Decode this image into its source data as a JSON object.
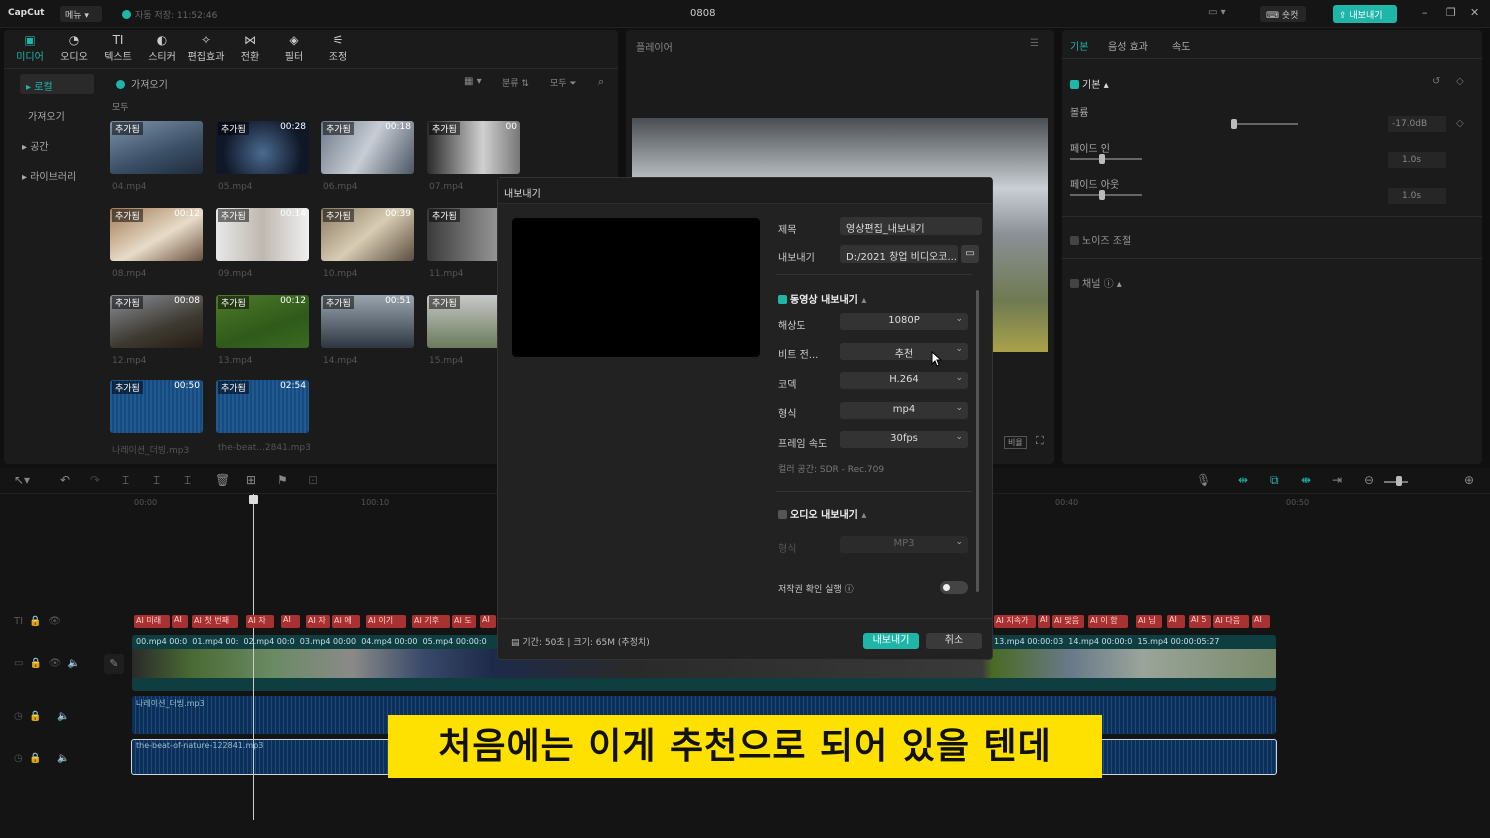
{
  "topbar": {
    "logo": "CapCut",
    "menu": "메뉴",
    "autosave": "자동 저장: 11:52:46",
    "project_name": "0808",
    "shortcut": "숏컷",
    "export": "내보내기"
  },
  "media_tabs": [
    "미디어",
    "오디오",
    "텍스트",
    "스티커",
    "편집효과",
    "전환",
    "필터",
    "조정"
  ],
  "sidebar": [
    "로컬",
    "가져오기",
    "공간",
    "라이브러리"
  ],
  "media_header": {
    "import": "가져오기",
    "sort": "분류",
    "all_filter": "모두",
    "section": "모두"
  },
  "media_items": [
    {
      "tag": "추가됨",
      "dur": "",
      "name": "04.mp4"
    },
    {
      "tag": "추가됨",
      "dur": "00:28",
      "name": "05.mp4"
    },
    {
      "tag": "추가됨",
      "dur": "00:18",
      "name": "06.mp4"
    },
    {
      "tag": "추가됨",
      "dur": "00",
      "name": "07.mp4"
    },
    {
      "tag": "추가됨",
      "dur": "00:12",
      "name": "08.mp4"
    },
    {
      "tag": "추가됨",
      "dur": "00:14",
      "name": "09.mp4"
    },
    {
      "tag": "추가됨",
      "dur": "00:39",
      "name": "10.mp4"
    },
    {
      "tag": "추가됨",
      "dur": "",
      "name": "11.mp4"
    },
    {
      "tag": "추가됨",
      "dur": "00:08",
      "name": "12.mp4"
    },
    {
      "tag": "추가됨",
      "dur": "00:12",
      "name": "13.mp4"
    },
    {
      "tag": "추가됨",
      "dur": "00:51",
      "name": "14.mp4"
    },
    {
      "tag": "추가됨",
      "dur": "",
      "name": "15.mp4"
    },
    {
      "tag": "추가됨",
      "dur": "00:50",
      "name": "나레이션_더빙.mp3"
    },
    {
      "tag": "추가됨",
      "dur": "02:54",
      "name": "the-beat...2841.mp3"
    }
  ],
  "player": {
    "title": "플레이어",
    "ratio": "비율"
  },
  "right_panel": {
    "tabs": [
      "기본",
      "음성 효과",
      "속도"
    ],
    "basic": "기본",
    "volume_label": "볼륨",
    "volume_value": "-17.0dB",
    "fade_in_label": "페이드 인",
    "fade_in_value": "1.0s",
    "fade_out_label": "페이드 아웃",
    "fade_out_value": "1.0s",
    "noise": "노이즈 조절",
    "channel": "채널"
  },
  "timeline": {
    "ticks": [
      "00:00",
      "100:10",
      "00:40",
      "00:50"
    ],
    "audio1": "나레이션_더빙.mp3",
    "audio2": "the-beat-of-nature-122841.mp3",
    "video_clips": [
      "00.mp4",
      "00:0",
      "01.mp4",
      "00:",
      "02.mp4",
      "00:0",
      "03.mp4",
      "00:00",
      "04.mp4",
      "00:00",
      "05.mp4",
      "00:00:0",
      "13.mp4",
      "00:00:03",
      "14.mp4",
      "00:00:0",
      "15.mp4",
      "00:00:05:27"
    ],
    "text_chips": [
      "AI 미래",
      "AI",
      "AI 첫 번째",
      "AI 자",
      "AI",
      "AI 자",
      "AI 에",
      "AI 이기",
      "AI 기후",
      "AI 도",
      "AI",
      "AI 지속가",
      "AI",
      "AI 맞음",
      "AI 이 함",
      "AI 님",
      "AI",
      "AI 5",
      "AI 다음",
      "AI"
    ]
  },
  "dialog": {
    "title": "내보내기",
    "title_label": "제목",
    "title_value": "영상편집_내보내기",
    "export_label": "내보내기",
    "path_value": "D:/2021 창업 비디오코...",
    "video_section": "동영상 내보내기",
    "resolution_label": "해상도",
    "resolution_value": "1080P",
    "bitrate_label": "비트 전...",
    "bitrate_value": "추천",
    "codec_label": "코덱",
    "codec_value": "H.264",
    "format_label": "형식",
    "format_value": "mp4",
    "fps_label": "프레임 속도",
    "fps_value": "30fps",
    "color_space": "컬러 공간: SDR - Rec.709",
    "audio_section": "오디오 내보내기",
    "audio_format_label": "형식",
    "audio_format_value": "MP3",
    "copyright_label": "저작권 확인 실행",
    "info": "기간: 50초 | 크기: 65M (추정치)",
    "export_button": "내보내기",
    "cancel_button": "취소"
  },
  "subtitle": "처음에는 이게 추천으로 되어 있을 텐데",
  "colors": {
    "accent": "#1fb5a8",
    "subtitle_bg": "#ffe100",
    "dialog_bg": "#222222"
  }
}
